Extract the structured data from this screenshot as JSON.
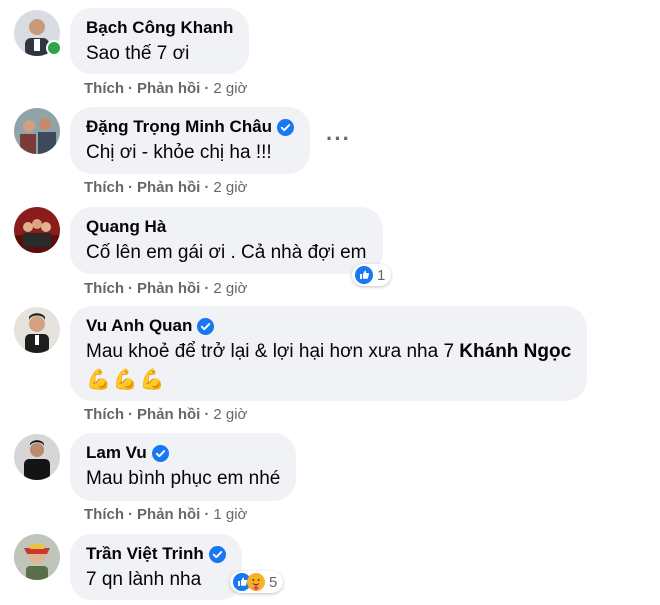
{
  "actions": {
    "like": "Thích",
    "reply": "Phản hồi",
    "sep": "·"
  },
  "more_label": "···",
  "comments": [
    {
      "name": "Bạch Công Khanh",
      "text": "Sao thế 7 ơi",
      "time": "2 giờ"
    },
    {
      "name": "Đặng Trọng Minh Châu",
      "text": "Chị ơi - khỏe chị ha !!!",
      "time": "2 giờ"
    },
    {
      "name": "Quang Hà",
      "text": "Cố lên em gái ơi . Cả nhà đợi em",
      "time": "2 giờ",
      "reaction_count": "1"
    },
    {
      "name": "Vu Anh Quan",
      "text_pre": "Mau khoẻ để trở lại & lợi hại hơn xưa nha 7 ",
      "text_mention": "Khánh Ngọc",
      "emojis": [
        "💪",
        "💪",
        "💪"
      ],
      "time": "2 giờ"
    },
    {
      "name": "Lam Vu",
      "text": "Mau bình phục em nhé",
      "time": "1 giờ"
    },
    {
      "name": "Trần Việt Trinh",
      "text": "7 qn lành nha",
      "reaction_count": "5"
    }
  ],
  "colors": {
    "bubble": "#f0f2f5",
    "verified": "#1877f2",
    "online": "#31a24c",
    "meta": "#65676b"
  }
}
